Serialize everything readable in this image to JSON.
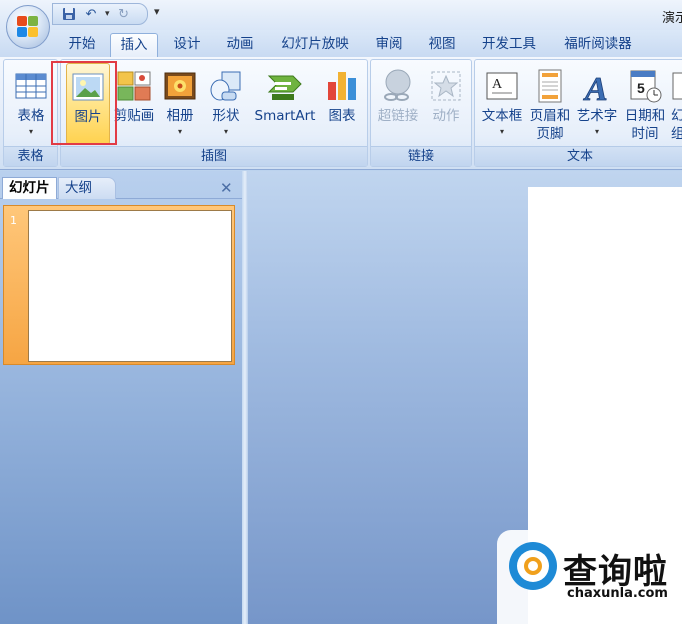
{
  "window": {
    "title": "演示"
  },
  "quick_access": {
    "undo_icon": "undo-icon",
    "redo_icon": "redo-icon",
    "customize": "▾"
  },
  "tabs": [
    {
      "label": "开始"
    },
    {
      "label": "插入"
    },
    {
      "label": "设计"
    },
    {
      "label": "动画"
    },
    {
      "label": "幻灯片放映"
    },
    {
      "label": "审阅"
    },
    {
      "label": "视图"
    },
    {
      "label": "开发工具"
    },
    {
      "label": "福昕阅读器"
    }
  ],
  "active_tab": "插入",
  "ribbon": {
    "groups": [
      {
        "label": "表格",
        "buttons": [
          {
            "label": "表格",
            "icon": "table-icon"
          }
        ]
      },
      {
        "label": "插图",
        "buttons": [
          {
            "label": "图片",
            "icon": "picture-icon",
            "selected": true
          },
          {
            "label": "剪贴画",
            "icon": "clipart-icon"
          },
          {
            "label": "相册",
            "icon": "photo-album-icon"
          },
          {
            "label": "形状",
            "icon": "shapes-icon"
          },
          {
            "label": "SmartArt",
            "icon": "smartart-icon"
          },
          {
            "label": "图表",
            "icon": "chart-icon"
          }
        ]
      },
      {
        "label": "链接",
        "buttons": [
          {
            "label": "超链接",
            "icon": "hyperlink-icon",
            "disabled": true
          },
          {
            "label": "动作",
            "icon": "action-icon",
            "disabled": true
          }
        ]
      },
      {
        "label": "文本",
        "buttons": [
          {
            "label": "文本框",
            "icon": "textbox-icon"
          },
          {
            "label": "页眉和",
            "label2": "页脚",
            "icon": "header-footer-icon"
          },
          {
            "label": "艺术字",
            "icon": "wordart-icon"
          },
          {
            "label": "日期和",
            "label2": "时间",
            "icon": "date-time-icon"
          },
          {
            "label": "幻",
            "label2": "组",
            "icon": "slide-number-icon"
          }
        ]
      }
    ]
  },
  "left_pane": {
    "tabs": [
      {
        "label": "幻灯片"
      },
      {
        "label": "大纲"
      }
    ],
    "close": "✕",
    "slides": [
      {
        "number": "1"
      }
    ]
  },
  "watermark": {
    "title": "查询啦",
    "url": "chaxunla.com"
  },
  "colors": {
    "accent": "#15428b",
    "highlight_box": "#e23b45",
    "selected_button": "#ffd24f",
    "thumb_frame": "#f6a543"
  }
}
